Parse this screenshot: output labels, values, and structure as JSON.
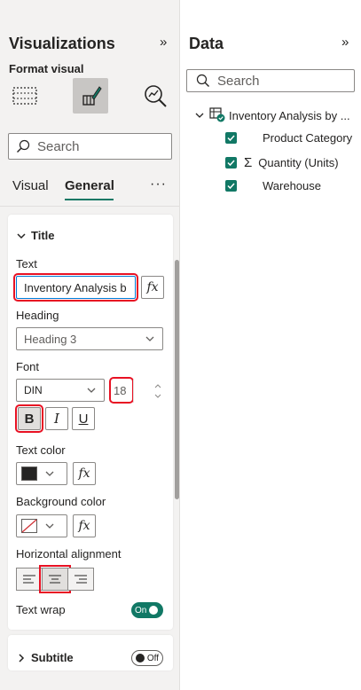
{
  "visualizations": {
    "title": "Visualizations",
    "collapse_glyph": "»",
    "subtitle": "Format visual",
    "icons": [
      "build-visual-icon",
      "format-visual-icon",
      "analytics-icon"
    ],
    "search_placeholder": "Search",
    "tabs": [
      "Visual",
      "General"
    ],
    "active_tab": "General",
    "more_glyph": "···",
    "title_section": {
      "header": "Title",
      "text_label": "Text",
      "text_value": "Inventory Analysis b",
      "fx_glyph": "fx",
      "heading_label": "Heading",
      "heading_value": "Heading 3",
      "font_label": "Font",
      "font_value": "DIN",
      "font_size": "18",
      "bold_glyph": "B",
      "italic_glyph": "I",
      "underline_glyph": "U",
      "text_color_label": "Text color",
      "text_color": "#252423",
      "bg_color_label": "Background color",
      "align_label": "Horizontal alignment",
      "align_active": "center",
      "wrap_label": "Text wrap",
      "wrap_state": "On"
    },
    "subtitle_section": {
      "header": "Subtitle",
      "state": "Off"
    }
  },
  "data": {
    "title": "Data",
    "collapse_glyph": "»",
    "search_placeholder": "Search",
    "table_name": "Inventory Analysis by ...",
    "fields": [
      {
        "name": "Product Category",
        "checked": true,
        "sigma": false
      },
      {
        "name": "Quantity (Units)",
        "checked": true,
        "sigma": true
      },
      {
        "name": "Warehouse",
        "checked": true,
        "sigma": false
      }
    ]
  },
  "colors": {
    "accent": "#117865",
    "highlight": "#e81123"
  }
}
